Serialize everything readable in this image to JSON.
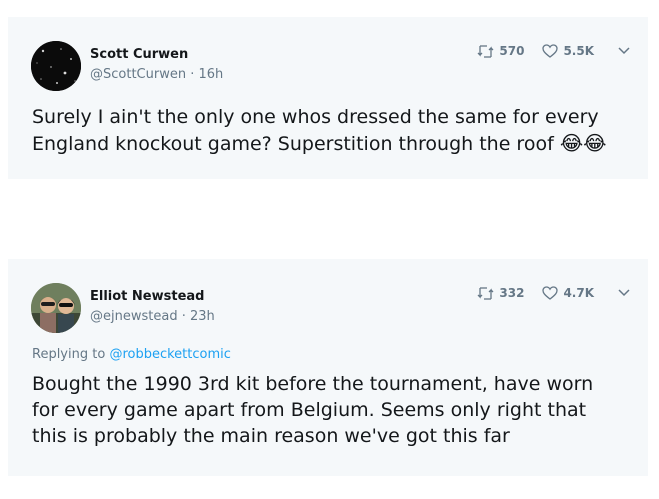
{
  "tweets": [
    {
      "name": "Scott Curwen",
      "handle": "@ScottCurwen · 16h",
      "retweets": "570",
      "likes": "5.5K",
      "text": "Surely I ain't the only one whos dressed the same for every England knockout game? Superstition through the roof ",
      "emoji": "😂😂"
    },
    {
      "name": "Elliot Newstead",
      "handle": "@ejnewstead · 23h",
      "retweets": "332",
      "likes": "4.7K",
      "replying_prefix": "Replying to ",
      "replying_to": "@robbeckettcomic",
      "text": "Bought the 1990 3rd kit before the tournament, have worn for every game apart from Belgium. Seems only right that this is probably the main reason we've got this far"
    }
  ],
  "icons": {
    "retweet": "retweet-icon",
    "like": "heart-icon",
    "menu": "chevron-down-icon"
  },
  "colors": {
    "card_bg": "#f5f8fa",
    "secondary_text": "#657786",
    "link": "#1da1f2"
  }
}
